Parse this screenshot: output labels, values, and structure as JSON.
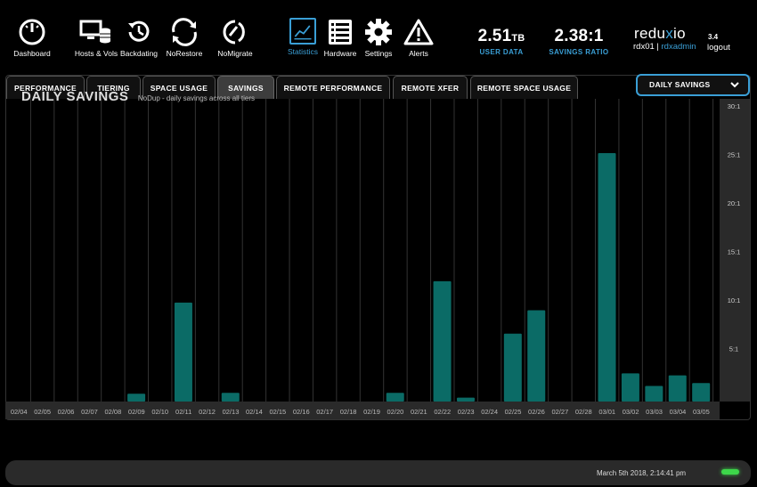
{
  "nav": [
    {
      "key": "dashboard",
      "label": "Dashboard"
    },
    {
      "key": "hosts",
      "label": "Hosts & Vols"
    },
    {
      "key": "backdating",
      "label": "Backdating"
    },
    {
      "key": "norestore",
      "label": "NoRestore"
    },
    {
      "key": "nomigrate",
      "label": "NoMigrate"
    },
    {
      "key": "statistics",
      "label": "Statistics",
      "active": true
    },
    {
      "key": "hardware",
      "label": "Hardware"
    },
    {
      "key": "settings",
      "label": "Settings"
    },
    {
      "key": "alerts",
      "label": "Alerts"
    }
  ],
  "stats": {
    "user_data_value": "2.51",
    "user_data_unit": "TB",
    "user_data_label": "USER DATA",
    "savings_ratio_value": "2.38:1",
    "savings_ratio_label": "SAVINGS RATIO"
  },
  "brand": {
    "text_a": "redu",
    "text_x": "x",
    "text_b": "io",
    "version": "3.4"
  },
  "user": {
    "system": "rdx01",
    "separator": "|",
    "name": "rdxadmin",
    "logout": "logout"
  },
  "tabs": [
    {
      "label": "PERFORMANCE"
    },
    {
      "label": "TIERING"
    },
    {
      "label": "SPACE USAGE"
    },
    {
      "label": "SAVINGS",
      "active": true
    },
    {
      "label": "REMOTE PERFORMANCE"
    },
    {
      "label": "REMOTE XFER"
    },
    {
      "label": "REMOTE SPACE USAGE"
    }
  ],
  "dropdown": {
    "selected": "DAILY SAVINGS"
  },
  "chart_data": {
    "type": "bar",
    "title": "DAILY SAVINGS",
    "subtitle": "NoDup - daily savings across all tiers",
    "categories": [
      "02/04",
      "02/05",
      "02/06",
      "02/07",
      "02/08",
      "02/09",
      "02/10",
      "02/11",
      "02/12",
      "02/13",
      "02/14",
      "02/15",
      "02/16",
      "02/17",
      "02/18",
      "02/19",
      "02/20",
      "02/21",
      "02/22",
      "02/23",
      "02/24",
      "02/25",
      "02/26",
      "02/27",
      "02/28",
      "03/01",
      "03/02",
      "03/03",
      "03/04",
      "03/05"
    ],
    "values": [
      0,
      0,
      0,
      0,
      0,
      0.8,
      0,
      10.2,
      0,
      0.9,
      0,
      0,
      0,
      0,
      0,
      0,
      0.9,
      0,
      12.4,
      0.4,
      0,
      7,
      9.4,
      0,
      0,
      25.6,
      2.9,
      1.6,
      2.7,
      1.9
    ],
    "ylim": [
      0,
      32
    ],
    "y_ticks": [
      5,
      10,
      15,
      20,
      25,
      30
    ],
    "y_tick_labels": [
      "5:1",
      "10:1",
      "15:1",
      "20:1",
      "25:1",
      "30:1"
    ],
    "bar_color": "#0b6b66",
    "grid": true
  },
  "status": {
    "datetime": "March 5th 2018, 2:14:41 pm"
  },
  "colors": {
    "accent": "#3a9fd6",
    "bar": "#0b6b66",
    "led": "#3dd64a"
  }
}
